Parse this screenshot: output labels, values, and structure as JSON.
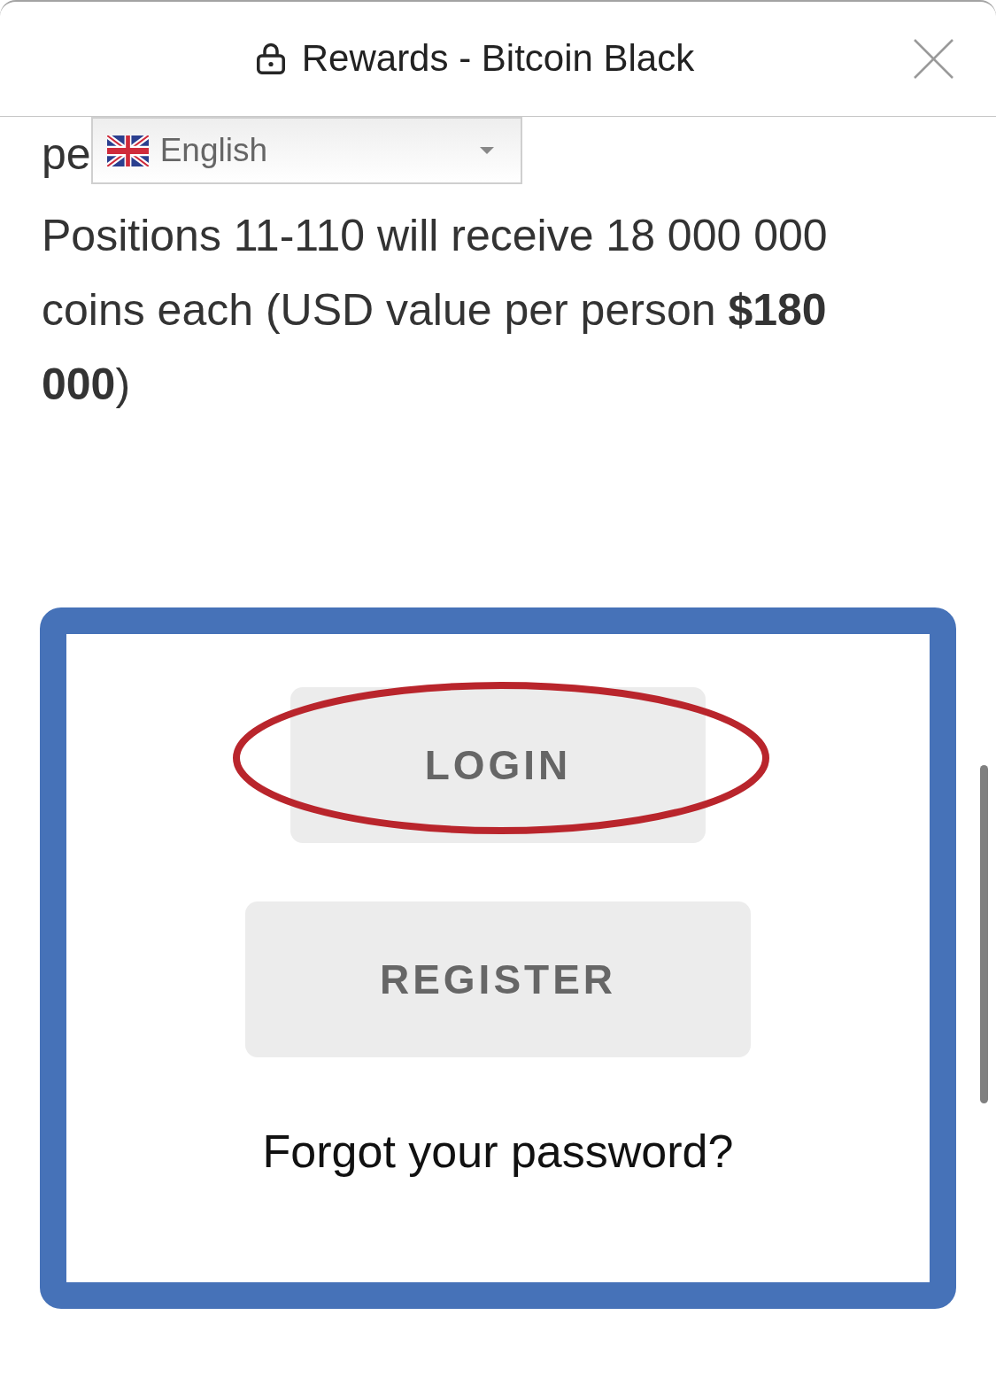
{
  "header": {
    "title": "Rewards - Bitcoin Black"
  },
  "language_selector": {
    "value": "English"
  },
  "content": {
    "partial_text": "pe",
    "paragraph": "Positions 11-110 will receive 18 000 000 coins each (USD value per person **$180 000**)"
  },
  "auth_box": {
    "buttons": [
      {
        "label": "LOGIN",
        "circled": true
      },
      {
        "label": "REGISTER",
        "circled": false
      }
    ],
    "link": "Forgot your password?"
  }
}
